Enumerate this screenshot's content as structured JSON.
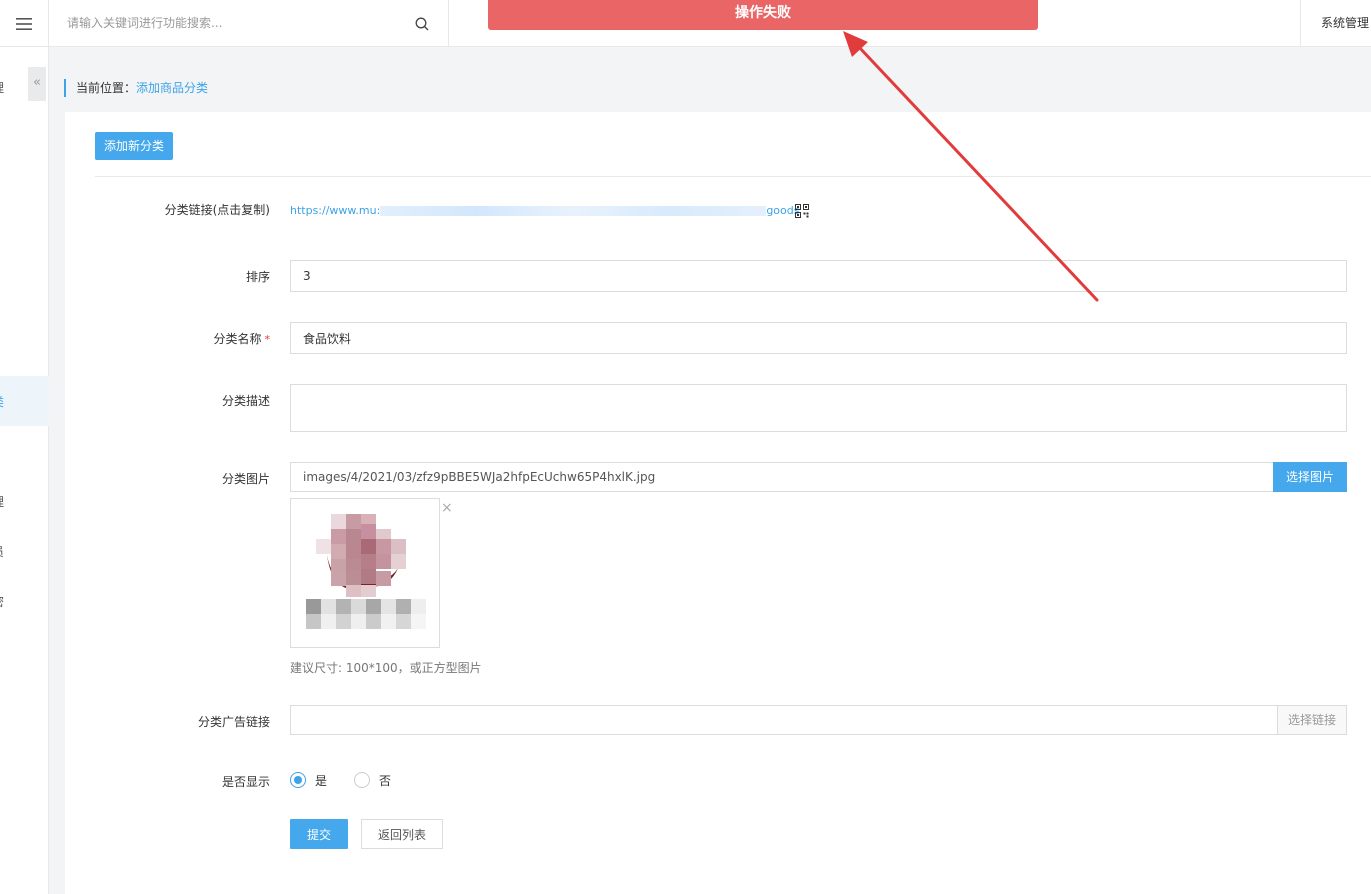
{
  "header": {
    "search_placeholder": "请输入关键词进行功能搜索...",
    "system_manage": "系统管理"
  },
  "toast": {
    "message": "操作失败"
  },
  "sidebar": {
    "items": [
      {
        "label": "理"
      },
      {
        "label": "类"
      },
      {
        "label": "理"
      },
      {
        "label": "员"
      },
      {
        "label": "密"
      }
    ],
    "collapse_glyph": "«"
  },
  "breadcrumb": {
    "prefix": "当前位置：",
    "current": "添加商品分类"
  },
  "form": {
    "add_button": "添加新分类",
    "link_label": "分类链接(点击复制)",
    "link_prefix": "https://www.mu:",
    "link_suffix": "goods",
    "sort_label": "排序",
    "sort_value": "3",
    "name_label": "分类名称",
    "name_required": "*",
    "name_value": "食品饮料",
    "desc_label": "分类描述",
    "desc_value": "",
    "image_label": "分类图片",
    "image_value": "images/4/2021/03/zfz9pBBE5WJa2hfpEcUchw65P4hxlK.jpg",
    "image_button": "选择图片",
    "image_close": "×",
    "image_hint": "建议尺寸: 100*100，或正方型图片",
    "ad_label": "分类广告链接",
    "ad_value": "",
    "ad_button": "选择链接",
    "show_label": "是否显示",
    "show_yes": "是",
    "show_no": "否",
    "show_selected": "是",
    "submit_button": "提交",
    "back_button": "返回列表"
  },
  "colors": {
    "accent": "#45a8ec",
    "toast": "#e96566",
    "arrow": "#e23b3b"
  }
}
